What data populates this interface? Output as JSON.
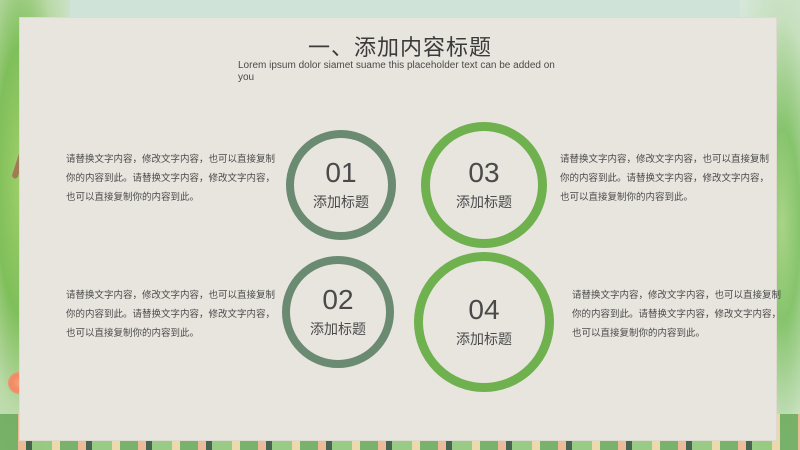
{
  "slide": {
    "title": "一、添加内容标题",
    "subtitle": "Lorem ipsum dolor siamet suame this placeholder text can be added on you",
    "items": [
      {
        "number": "01",
        "label": "添加标题",
        "text": "请替换文字内容，修改文字内容，也可以直接复制你的内容到此。请替换文字内容，修改文字内容，也可以直接复制你的内容到此。"
      },
      {
        "number": "02",
        "label": "添加标题",
        "text": "请替换文字内容，修改文字内容，也可以直接复制你的内容到此。请替换文字内容，修改文字内容，也可以直接复制你的内容到此。"
      },
      {
        "number": "03",
        "label": "添加标题",
        "text": "请替换文字内容，修改文字内容，也可以直接复制你的内容到此。请替换文字内容，修改文字内容，也可以直接复制你的内容到此。"
      },
      {
        "number": "04",
        "label": "添加标题",
        "text": "请替换文字内容，修改文字内容，也可以直接复制你的内容到此。请替换文字内容，修改文字内容，也可以直接复制你的内容到此。"
      }
    ]
  },
  "colors": {
    "dark_ring": "#6b8a72",
    "green_ring": "#6fb14e",
    "panel": "#e8e5df"
  }
}
